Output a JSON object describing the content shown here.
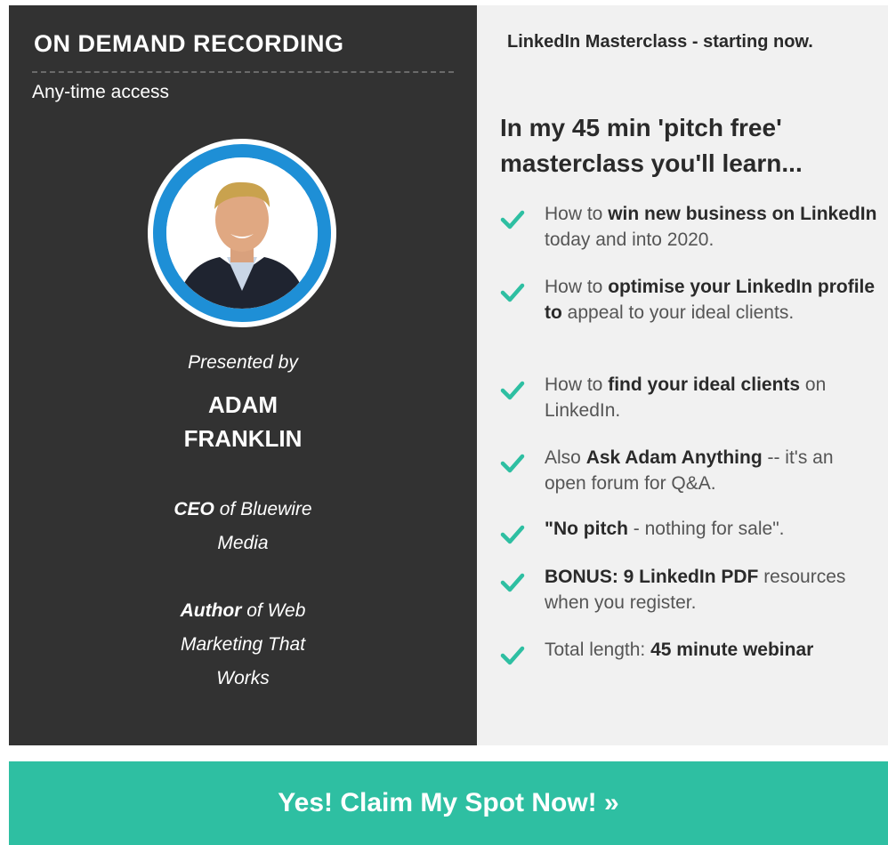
{
  "left": {
    "heading": "ON DEMAND RECORDING",
    "subheading": "Any-time access",
    "presented_by": "Presented by",
    "name_line1": "ADAM",
    "name_line2": "FRANKLIN",
    "role_bold": "CEO",
    "role_rest": " of Bluewire",
    "role_line2": "Media",
    "author_bold": "Author",
    "author_rest": " of Web",
    "author_line2": "Marketing That",
    "author_line3": "Works"
  },
  "right": {
    "top_line": "LinkedIn Masterclass - starting now.",
    "headline_line1": "In my 45 min 'pitch free'",
    "headline_line2": "masterclass you'll learn...",
    "benefits": [
      {
        "pre": "How to ",
        "bold": "win new business on LinkedIn",
        "post": " today and into 2020."
      },
      {
        "pre": "How to ",
        "bold": "optimise your LinkedIn profile to",
        "post": " appeal to your ideal clients."
      },
      {
        "pre": "How to ",
        "bold": "find your ideal clients",
        "post": " on LinkedIn."
      },
      {
        "pre": "Also ",
        "bold": "Ask Adam Anything",
        "post": " -- it's an open forum for Q&A."
      },
      {
        "pre": "",
        "bold": "\"No pitch",
        "post": " - nothing for sale\"."
      },
      {
        "pre": "",
        "bold": "BONUS:  9 LinkedIn PDF",
        "post": " resources when you register."
      },
      {
        "pre": "Total length: ",
        "bold": "45 minute webinar",
        "post": ""
      }
    ]
  },
  "cta": {
    "label": "Yes! Claim My Spot Now! »"
  },
  "colors": {
    "left_bg": "#323232",
    "right_bg": "#f1f1f1",
    "accent_teal": "#2ebfa2",
    "avatar_ring": "#1e8fd6"
  },
  "icons": {
    "benefit": "check-icon",
    "avatar": "presenter-photo"
  }
}
